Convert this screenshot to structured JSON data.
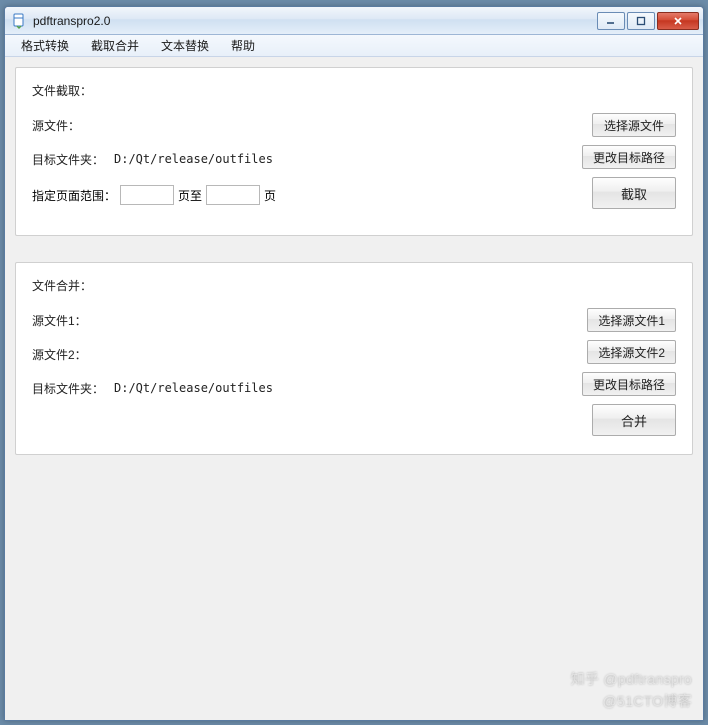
{
  "window": {
    "title": "pdftranspro2.0"
  },
  "menubar": {
    "items": [
      "格式转换",
      "截取合并",
      "文本替换",
      "帮助"
    ]
  },
  "extract": {
    "title": "文件截取：",
    "source_label": "源文件：",
    "source_value": "",
    "target_label": "目标文件夹：",
    "target_value": "D:/Qt/release/outfiles",
    "range_label": "指定页面范围：",
    "page_from": "",
    "page_mid": "页至",
    "page_to": "",
    "page_suffix": "页",
    "btn_select_source": "选择源文件",
    "btn_change_target": "更改目标路径",
    "btn_extract": "截取"
  },
  "merge": {
    "title": "文件合并：",
    "source1_label": "源文件1：",
    "source1_value": "",
    "source2_label": "源文件2：",
    "source2_value": "",
    "target_label": "目标文件夹：",
    "target_value": "D:/Qt/release/outfiles",
    "btn_select_source1": "选择源文件1",
    "btn_select_source2": "选择源文件2",
    "btn_change_target": "更改目标路径",
    "btn_merge": "合并"
  },
  "watermark": {
    "line1": "知乎 @pdftranspro",
    "line2": "@51CTO博客"
  }
}
